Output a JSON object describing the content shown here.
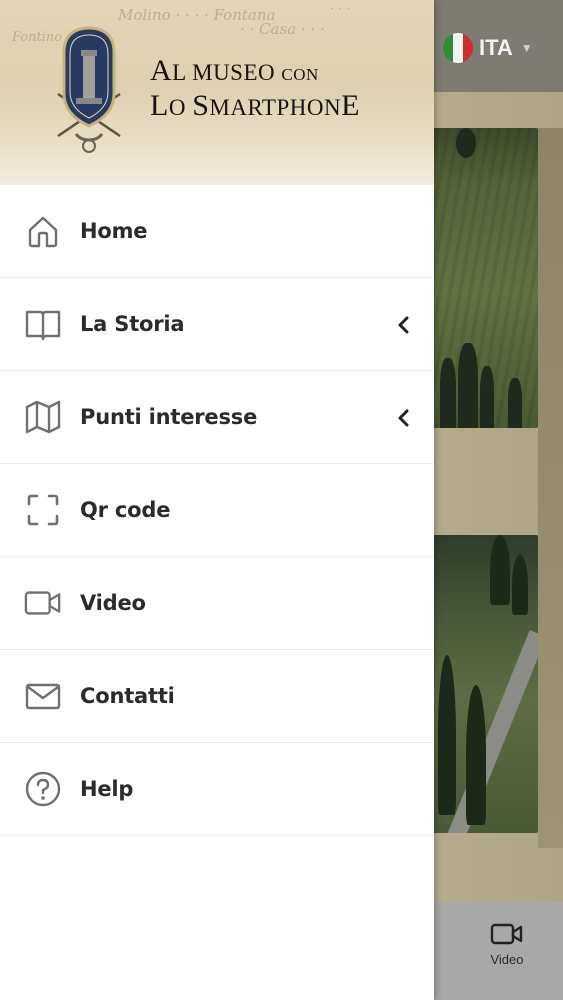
{
  "header": {
    "brand_line1": "Al museo con",
    "brand_line2": "Lo Smartphone",
    "brand_line1_display": "AL MUSEO CON",
    "brand_line2_display": "LO SMARTPHONE",
    "emblem_icon": "club-crest-emblem"
  },
  "language": {
    "selected": "ITA",
    "flag_icon": "italy-flag-icon",
    "flag_colors": [
      "#2e8b3e",
      "#f2f2f2",
      "#c9302c"
    ]
  },
  "menu": {
    "items": [
      {
        "label": "Home",
        "icon": "home-icon",
        "has_submenu": false
      },
      {
        "label": "La Storia",
        "icon": "book-icon",
        "has_submenu": true
      },
      {
        "label": "Punti interesse",
        "icon": "map-icon",
        "has_submenu": true
      },
      {
        "label": "Qr code",
        "icon": "qr-scan-icon",
        "has_submenu": false
      },
      {
        "label": "Video",
        "icon": "video-camera-icon",
        "has_submenu": false
      },
      {
        "label": "Contatti",
        "icon": "envelope-icon",
        "has_submenu": false
      },
      {
        "label": "Help",
        "icon": "help-circle-icon",
        "has_submenu": false
      }
    ]
  },
  "bottom_bar": {
    "video_tab_label": "Video",
    "video_tab_icon": "video-camera-icon"
  },
  "colors": {
    "icon_gray": "#6f6f6f",
    "text_dark": "#2b2b2b",
    "divider": "#ececec"
  }
}
